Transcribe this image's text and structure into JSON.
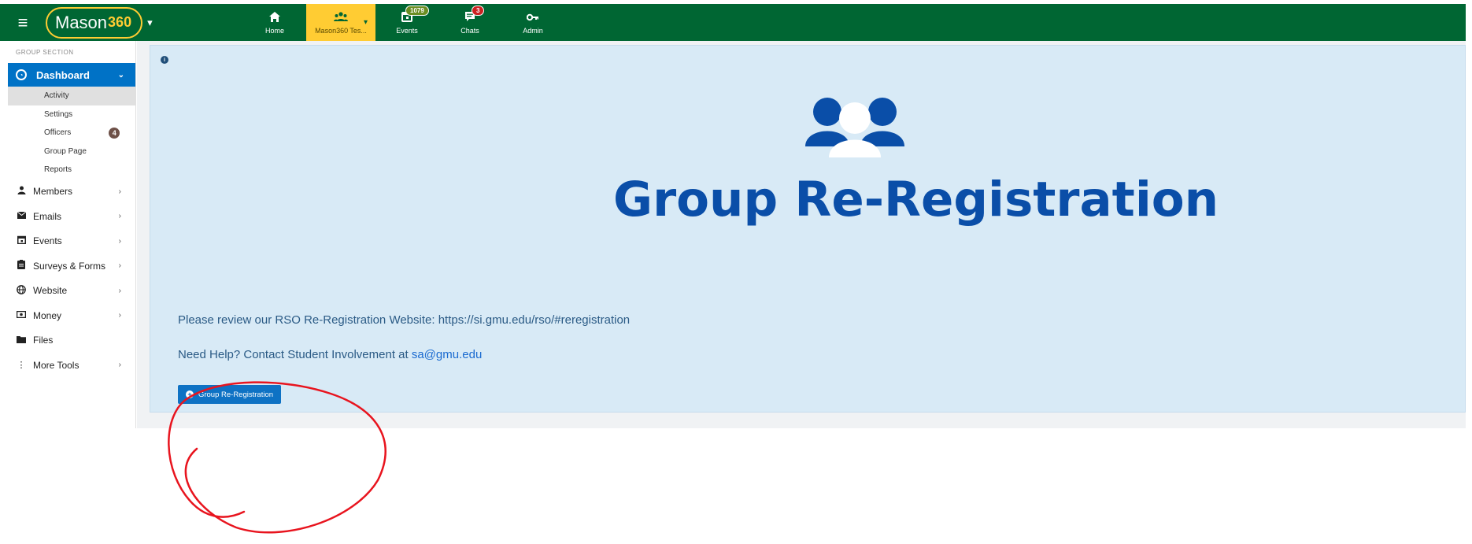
{
  "topbar": {
    "menu_icon": "hamburger-icon",
    "logo_text": "Mason",
    "logo_num": "360",
    "logo_caret": "▾",
    "nav": [
      {
        "label": "Home",
        "icon": "home-icon"
      },
      {
        "label": "Mason360 Tes...",
        "icon": "group-icon"
      },
      {
        "label": "Events",
        "icon": "calendar-icon",
        "badge": "1079"
      },
      {
        "label": "Chats",
        "icon": "chat-icon",
        "badge": "3"
      },
      {
        "label": "Admin",
        "icon": "key-icon"
      }
    ]
  },
  "sidebar": {
    "heading": "GROUP SECTION",
    "dashboard": "Dashboard",
    "sub": [
      {
        "label": "Activity"
      },
      {
        "label": "Settings"
      },
      {
        "label": "Officers",
        "badge": "4"
      },
      {
        "label": "Group Page"
      },
      {
        "label": "Reports"
      }
    ],
    "menu": [
      {
        "label": "Members",
        "icon": "person-icon"
      },
      {
        "label": "Emails",
        "icon": "envelope-icon"
      },
      {
        "label": "Events",
        "icon": "calendar-icon"
      },
      {
        "label": "Surveys & Forms",
        "icon": "clipboard-icon"
      },
      {
        "label": "Website",
        "icon": "globe-icon"
      },
      {
        "label": "Money",
        "icon": "money-icon"
      },
      {
        "label": "Files",
        "icon": "folder-icon"
      },
      {
        "label": "More Tools",
        "icon": "more-icon"
      }
    ]
  },
  "main": {
    "title": "Group Re-Registration",
    "review_text": "Please review our RSO Re-Registration Website: ",
    "review_link": "https://si.gmu.edu/rso/#reregistration",
    "help_text": "Need Help? Contact Student Involvement at ",
    "help_email": "sa@gmu.edu",
    "button_label": "Group Re-Registration"
  },
  "colors": {
    "topbar": "#006633",
    "accent_gold": "#ffcc33",
    "primary_blue": "#0072c6",
    "panel_bg": "#d8eaf6",
    "title_blue": "#0a4ea8",
    "annotation_red": "#e8141e"
  }
}
